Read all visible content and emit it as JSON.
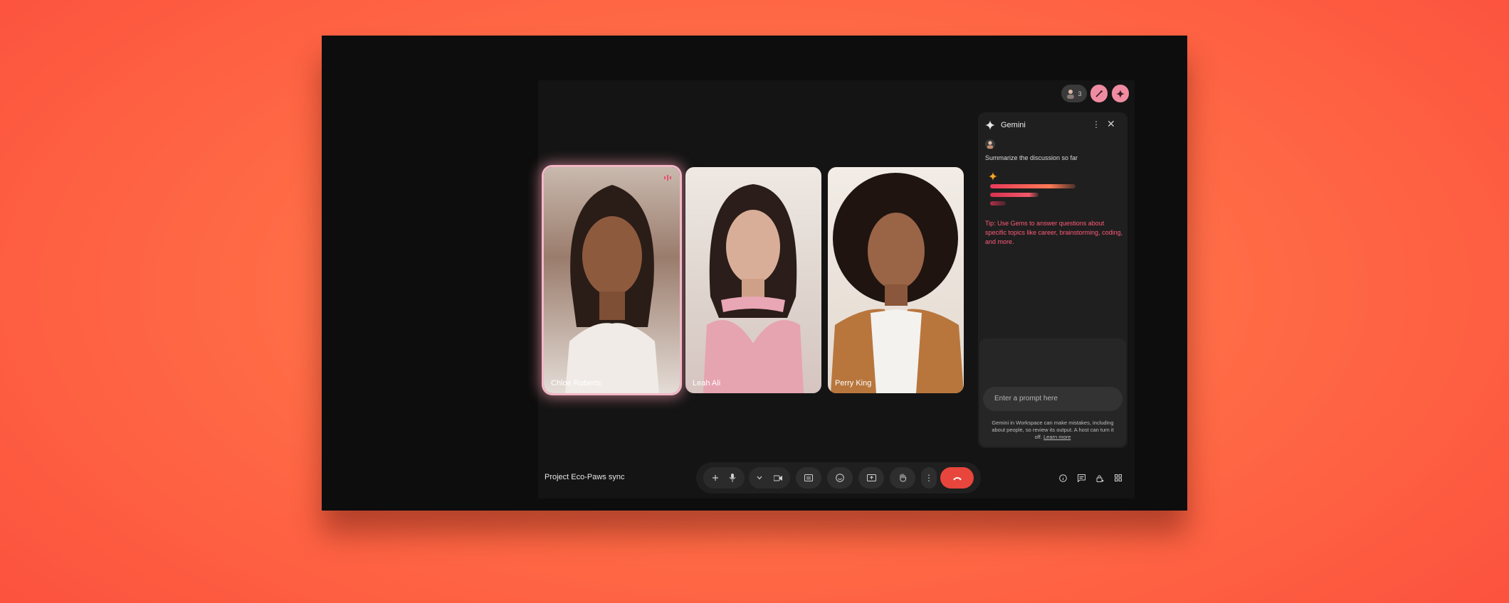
{
  "meeting": {
    "title": "Project Eco-Paws sync",
    "participant_count": "3",
    "colors": {
      "accent": "#f08ca2",
      "end_call": "#e8453c",
      "tip_text": "#ff5a7a"
    }
  },
  "participants": [
    {
      "name": "Chloe Roberts",
      "speaking": true
    },
    {
      "name": "Leah Ali",
      "speaking": false
    },
    {
      "name": "Perry King",
      "speaking": false
    }
  ],
  "gemini_panel": {
    "title": "Gemini",
    "user_prompt": "Summarize the discussion so far",
    "tip": "Tip: Use Gems to answer questions about specific topics like career, brainstorming, coding, and more.",
    "input_placeholder": "Enter a prompt here",
    "disclaimer": "Gemini in Workspace can make mistakes, including about people, so review its output. A host can turn it off.",
    "learn_more": "Learn more"
  },
  "controls": {
    "icons": [
      "audio-options-icon",
      "microphone-icon",
      "chevron-down-icon",
      "camera-icon",
      "captions-icon",
      "emoji-icon",
      "present-icon",
      "raise-hand-icon",
      "more-options-icon",
      "end-call-icon"
    ],
    "right_icons": [
      "info-icon",
      "chat-icon",
      "host-controls-icon",
      "activities-icon"
    ]
  }
}
